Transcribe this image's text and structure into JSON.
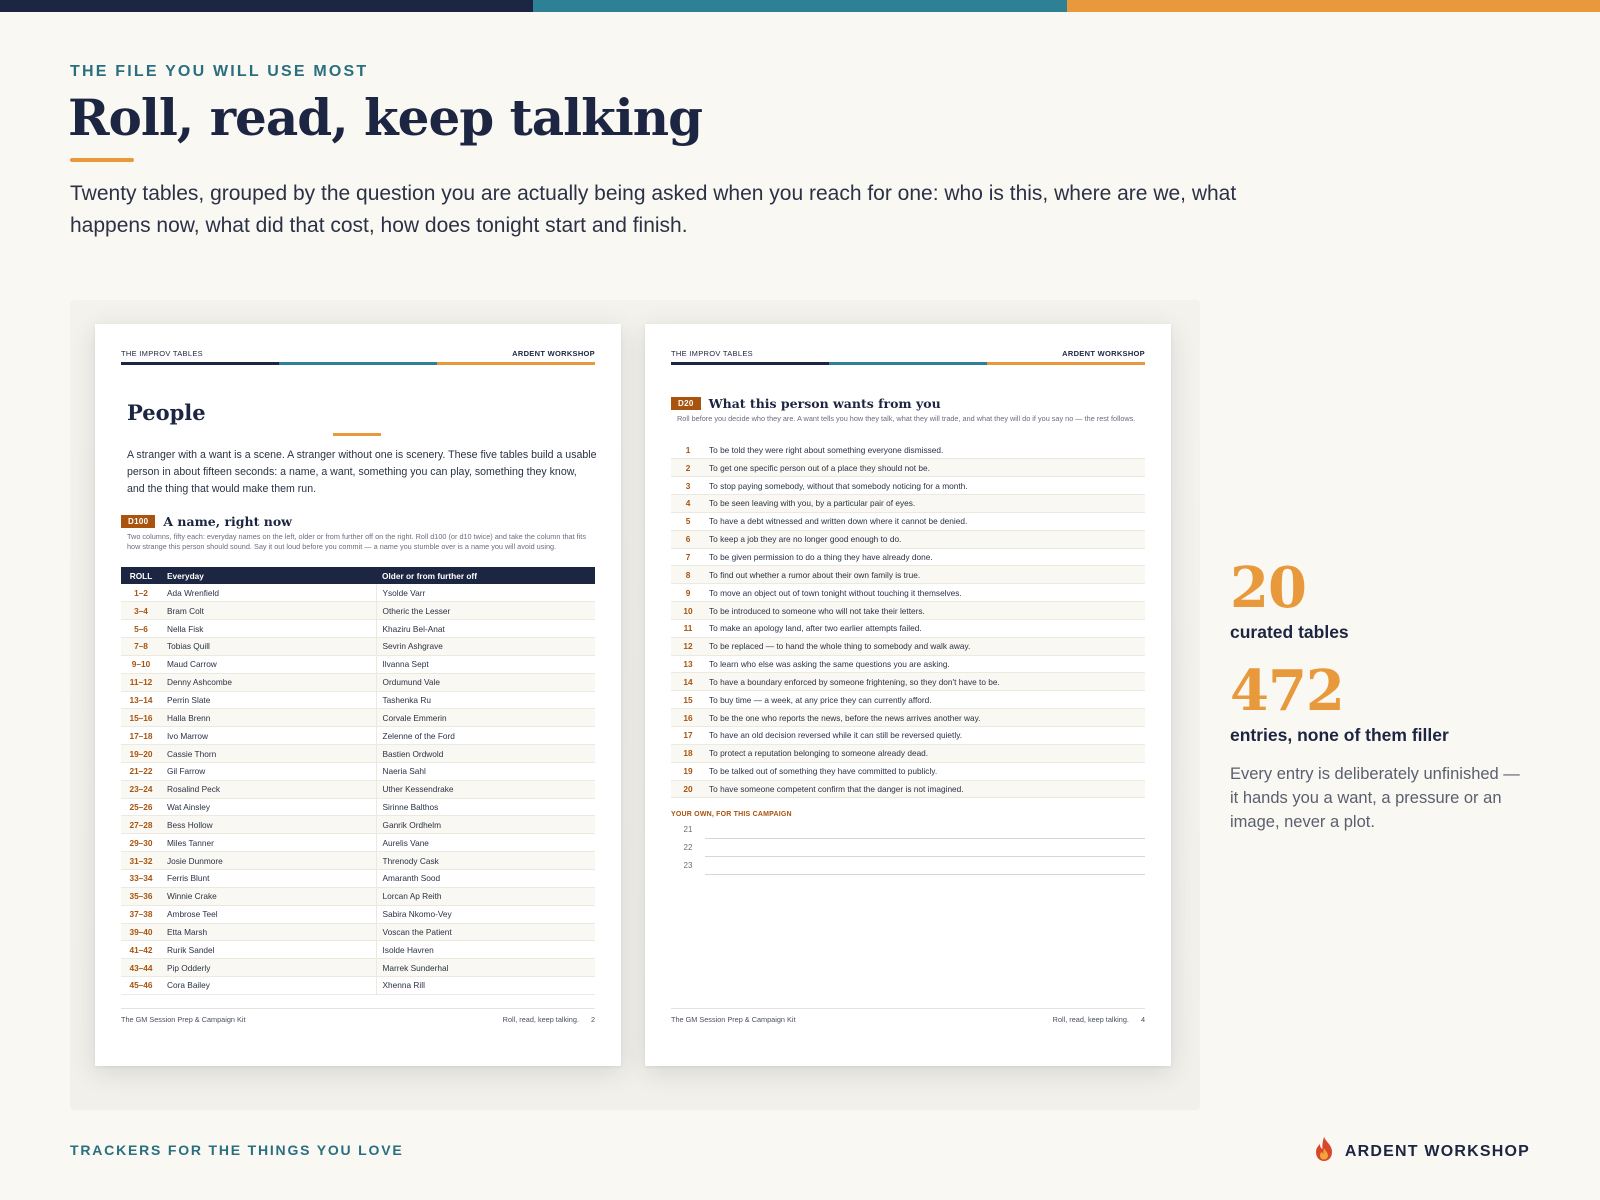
{
  "eyebrow": "THE FILE YOU WILL USE MOST",
  "headline": "Roll, read, keep talking",
  "intro": "Twenty tables, grouped by the question you are actually being asked when you reach for one: who is this, where are we, what happens now, what did that cost, how does tonight start and finish.",
  "colors": {
    "navy": "#1c2541",
    "teal": "#2e8194",
    "orange": "#e8993b",
    "rust": "#a8530e"
  },
  "left_page": {
    "header_left": "THE IMPROV TABLES",
    "header_right": "ARDENT WORKSHOP",
    "title": "People",
    "intro": "A stranger with a want is a scene. A stranger without one is scenery. These five tables build a usable person in about fifteen seconds: a name, a want, something you can play, something they know, and the thing that would make them run.",
    "table_die": "D100",
    "table_name": "A name, right now",
    "table_desc": "Two columns, fifty each: everyday names on the left, older or from further off on the right. Roll d100 (or d10 twice) and take the column that fits how strange this person should sound. Say it out loud before you commit — a name you stumble over is a name you will avoid using.",
    "columns": [
      "ROLL",
      "Everyday",
      "Older or from further off"
    ],
    "rows": [
      {
        "roll": "1–2",
        "a": "Ada Wrenfield",
        "b": "Ysolde Varr"
      },
      {
        "roll": "3–4",
        "a": "Bram Colt",
        "b": "Otheric the Lesser"
      },
      {
        "roll": "5–6",
        "a": "Nella Fisk",
        "b": "Khaziru Bel-Anat"
      },
      {
        "roll": "7–8",
        "a": "Tobias Quill",
        "b": "Sevrin Ashgrave"
      },
      {
        "roll": "9–10",
        "a": "Maud Carrow",
        "b": "Ilvanna Sept"
      },
      {
        "roll": "11–12",
        "a": "Denny Ashcombe",
        "b": "Ordumund Vale"
      },
      {
        "roll": "13–14",
        "a": "Perrin Slate",
        "b": "Tashenka Ru"
      },
      {
        "roll": "15–16",
        "a": "Halla Brenn",
        "b": "Corvale Emmerin"
      },
      {
        "roll": "17–18",
        "a": "Ivo Marrow",
        "b": "Zelenne of the Ford"
      },
      {
        "roll": "19–20",
        "a": "Cassie Thorn",
        "b": "Bastien Ordwold"
      },
      {
        "roll": "21–22",
        "a": "Gil Farrow",
        "b": "Naeria Sahl"
      },
      {
        "roll": "23–24",
        "a": "Rosalind Peck",
        "b": "Uther Kessendrake"
      },
      {
        "roll": "25–26",
        "a": "Wat Ainsley",
        "b": "Sirinne Balthos"
      },
      {
        "roll": "27–28",
        "a": "Bess Hollow",
        "b": "Ganrik Ordhelm"
      },
      {
        "roll": "29–30",
        "a": "Miles Tanner",
        "b": "Aurelis Vane"
      },
      {
        "roll": "31–32",
        "a": "Josie Dunmore",
        "b": "Threnody Cask"
      },
      {
        "roll": "33–34",
        "a": "Ferris Blunt",
        "b": "Amaranth Sood"
      },
      {
        "roll": "35–36",
        "a": "Winnie Crake",
        "b": "Lorcan Ap Reith"
      },
      {
        "roll": "37–38",
        "a": "Ambrose Teel",
        "b": "Sabira Nkomo-Vey"
      },
      {
        "roll": "39–40",
        "a": "Etta Marsh",
        "b": "Voscan the Patient"
      },
      {
        "roll": "41–42",
        "a": "Rurik Sandel",
        "b": "Isolde Havren"
      },
      {
        "roll": "43–44",
        "a": "Pip Odderly",
        "b": "Marrek Sunderhal"
      },
      {
        "roll": "45–46",
        "a": "Cora Bailey",
        "b": "Xhenna Rill"
      }
    ],
    "footer_left": "The GM Session Prep & Campaign Kit",
    "footer_right": "Roll, read, keep talking.",
    "page_number": "2"
  },
  "right_page": {
    "header_left": "THE IMPROV TABLES",
    "header_right": "ARDENT WORKSHOP",
    "table_die": "D20",
    "table_name": "What this person wants from you",
    "table_desc": "Roll before you decide who they are. A want tells you how they talk, what they will trade, and what they will do if you say no — the rest follows.",
    "rows": [
      {
        "roll": "1",
        "text": "To be told they were right about something everyone dismissed."
      },
      {
        "roll": "2",
        "text": "To get one specific person out of a place they should not be."
      },
      {
        "roll": "3",
        "text": "To stop paying somebody, without that somebody noticing for a month."
      },
      {
        "roll": "4",
        "text": "To be seen leaving with you, by a particular pair of eyes."
      },
      {
        "roll": "5",
        "text": "To have a debt witnessed and written down where it cannot be denied."
      },
      {
        "roll": "6",
        "text": "To keep a job they are no longer good enough to do."
      },
      {
        "roll": "7",
        "text": "To be given permission to do a thing they have already done."
      },
      {
        "roll": "8",
        "text": "To find out whether a rumor about their own family is true."
      },
      {
        "roll": "9",
        "text": "To move an object out of town tonight without touching it themselves."
      },
      {
        "roll": "10",
        "text": "To be introduced to someone who will not take their letters."
      },
      {
        "roll": "11",
        "text": "To make an apology land, after two earlier attempts failed."
      },
      {
        "roll": "12",
        "text": "To be replaced — to hand the whole thing to somebody and walk away."
      },
      {
        "roll": "13",
        "text": "To learn who else was asking the same questions you are asking."
      },
      {
        "roll": "14",
        "text": "To have a boundary enforced by someone frightening, so they don't have to be."
      },
      {
        "roll": "15",
        "text": "To buy time — a week, at any price they can currently afford."
      },
      {
        "roll": "16",
        "text": "To be the one who reports the news, before the news arrives another way."
      },
      {
        "roll": "17",
        "text": "To have an old decision reversed while it can still be reversed quietly."
      },
      {
        "roll": "18",
        "text": "To protect a reputation belonging to someone already dead."
      },
      {
        "roll": "19",
        "text": "To be talked out of something they have committed to publicly."
      },
      {
        "roll": "20",
        "text": "To have someone competent confirm that the danger is not imagined."
      }
    ],
    "own_label": "YOUR OWN, FOR THIS CAMPAIGN",
    "own_rows": [
      "21",
      "22",
      "23"
    ],
    "footer_left": "The GM Session Prep & Campaign Kit",
    "footer_right": "Roll, read, keep talking.",
    "page_number": "4"
  },
  "stats": [
    {
      "value": "20",
      "label": "curated tables"
    },
    {
      "value": "472",
      "label": "entries, none of them filler"
    }
  ],
  "stat_note": "Every entry is deliberately unfinished — it hands you a want, a pressure or an image, never a plot.",
  "footer": {
    "tagline": "TRACKERS FOR THE THINGS YOU LOVE",
    "brand": "ARDENT WORKSHOP",
    "brand_icon": "flame-icon"
  }
}
